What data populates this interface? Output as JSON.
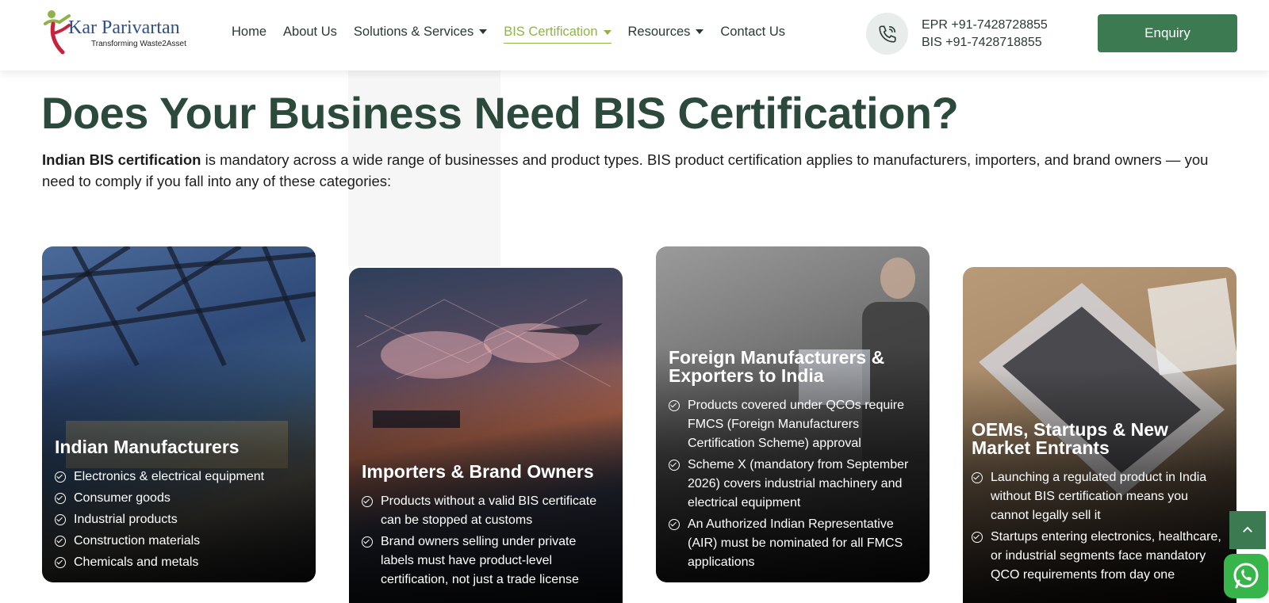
{
  "header": {
    "logo_name": "Kar Parivartan",
    "logo_tagline": "Transforming Waste2Asset",
    "nav": [
      {
        "label": "Home",
        "has_caret": false,
        "active": false
      },
      {
        "label": "About Us",
        "has_caret": false,
        "active": false
      },
      {
        "label": "Solutions & Services",
        "has_caret": true,
        "active": false
      },
      {
        "label": "BIS Certification",
        "has_caret": true,
        "active": true
      },
      {
        "label": "Resources",
        "has_caret": true,
        "active": false
      },
      {
        "label": "Contact Us",
        "has_caret": false,
        "active": false
      }
    ],
    "phone_epr": "EPR +91-7428728855",
    "phone_bis": "BIS +91-7428718855",
    "enquiry_label": "Enquiry"
  },
  "main": {
    "title": "Does Your Business Need BIS Certification?",
    "intro_bold": "Indian BIS certification",
    "intro_rest": " is mandatory across a wide range of businesses and product types. BIS product certification applies to manufacturers, importers, and brand owners — you need to comply if you fall into any of these categories:",
    "cards": [
      {
        "title": "Indian Manufacturers",
        "items": [
          "Electronics & electrical equipment",
          "Consumer goods",
          "Industrial products",
          "Construction materials",
          "Chemicals and metals"
        ]
      },
      {
        "title": "Importers & Brand Owners",
        "items": [
          "Products without a valid BIS certificate can be stopped at customs",
          "Brand owners selling under private labels must have product-level certification, not just a trade license"
        ]
      },
      {
        "title": "Foreign Manufacturers & Exporters to India",
        "items": [
          "Products covered under QCOs require FMCS (Foreign Manufacturers Certification Scheme) approval",
          "Scheme X (mandatory from September 2026) covers industrial machinery and electrical equipment",
          "An Authorized Indian Representative (AIR) must be nominated for all FMCS applications"
        ]
      },
      {
        "title": "OEMs, Startups & New Market Entrants",
        "items": [
          "Launching a regulated product in India without BIS certification means you cannot legally sell it",
          "Startups entering electronics, healthcare, or industrial segments face mandatory QCO requirements from day one"
        ]
      }
    ]
  },
  "colors": {
    "brand_green": "#3c7a52",
    "accent_lime": "#8fb348",
    "title_green": "#2b4a3c"
  },
  "icons": {
    "phone": "phone-icon",
    "check": "check-circle-icon",
    "scroll_top": "chevron-up-icon",
    "whatsapp": "whatsapp-icon"
  }
}
